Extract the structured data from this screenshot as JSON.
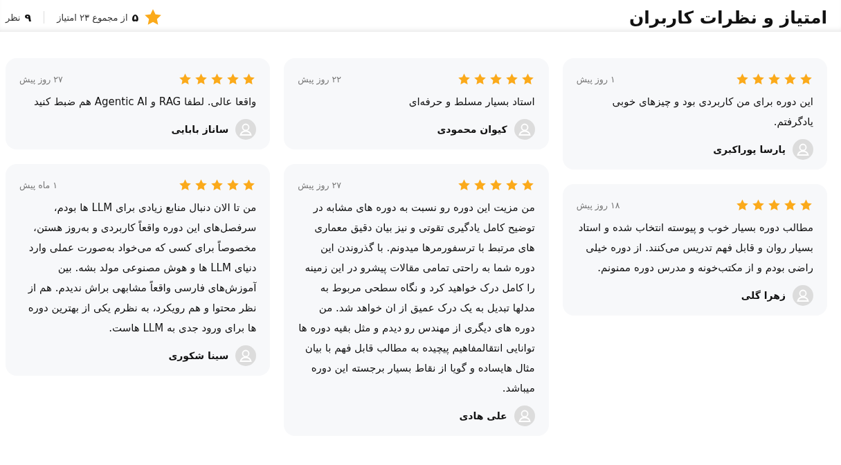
{
  "header": {
    "title": "امتیاز و نظرات کاربران",
    "average": "۵",
    "total_label": "از مجموع ۲۳ امتیاز",
    "count": "۹",
    "count_label": "نظر"
  },
  "columns": [
    [
      {
        "stars": 5,
        "date": "۱ روز پیش",
        "text": "این دوره برای من کاربردی بود و چیزهای خوبی یادگرفتم.",
        "author": "پارسا پوراکبری"
      },
      {
        "stars": 5,
        "date": "۱۸ روز پیش",
        "text": "مطالب دوره بسیار خوب و پیوسته انتخاب شده و استاد بسیار روان و قابل فهم تدریس می‌کنند. از دوره خیلی راضی بودم و از مکتب‌خونه و مدرس دوره ممنونم.",
        "author": "زهرا گلی"
      }
    ],
    [
      {
        "stars": 5,
        "date": "۲۲ روز پیش",
        "text": "استاد بسیار مسلط و حرفه‌ای",
        "author": "کیوان محمودی"
      },
      {
        "stars": 5,
        "date": "۲۷ روز پیش",
        "text": "من مزیت این دوره رو نسبت به دوره های مشابه در توضیح کامل یادگیری تقوتی و نیز بیان دقیق معماری های مرتبط با ترسفورمرها میدونم. با گذروندن این دوره شما به راحتی تمامی مقالات پیشرو در این زمینه را کامل درک خواهید کرد و نگاه سطحی مربوط به مدلها تبدیل به یک درک عمیق از ان خواهد شد. من دوره های دیگری از مهندس رو دیدم و مثل بقیه دوره ها توانایی انتقالمفاهیم پیچیده به مطالب قابل فهم با بیان مثال هایساده و گویا از نقاط بسیار برجسته این دوره میباشد.",
        "author": "علی هادی"
      }
    ],
    [
      {
        "stars": 5,
        "date": "۲۷ روز پیش",
        "text": "واقعا عالی. لطفا RAG و Agentic AI هم ضبط کنید",
        "author": "ساناز بابایی"
      },
      {
        "stars": 5,
        "date": "۱ ماه پیش",
        "text": "من تا الان دنبال منابع زیادی برای LLM ها بودم، سرفصل‌های این دوره واقعاً کاربردی و به‌روز هستن، مخصوصاً برای کسی که می‌خواد به‌صورت عملی وارد دنیای LLM ها و هوش مصنوعی مولد بشه. بین آموزش‌های فارسی واقعاً مشابهی براش ندیدم. هم از نظر محتوا و هم رویکرد، به نظرم یکی از بهترین دوره ها برای ورود جدی به LLM هاست.",
        "author": "سینا شکوری"
      }
    ]
  ]
}
